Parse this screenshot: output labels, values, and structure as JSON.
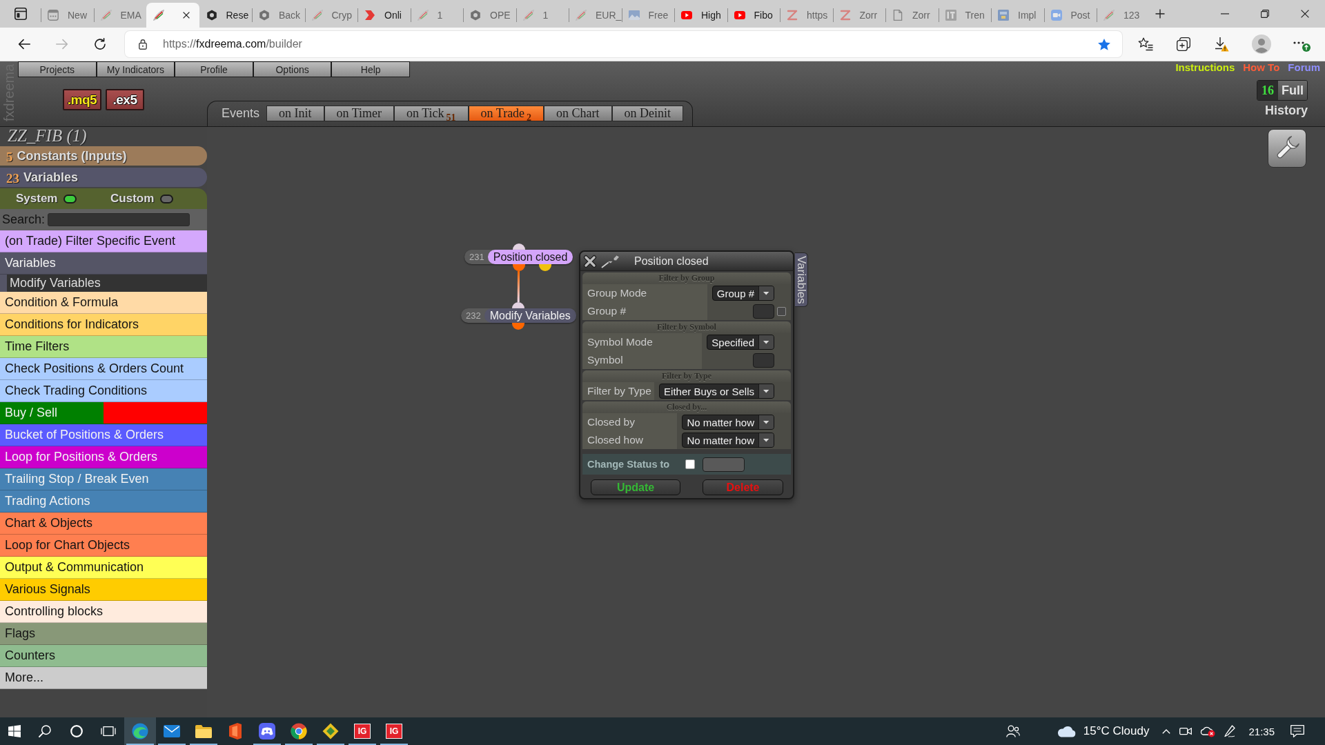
{
  "browser": {
    "tabs": [
      {
        "label": "New",
        "kind": "grid",
        "selected": false,
        "sleeping": true
      },
      {
        "label": "EMA",
        "kind": "quill",
        "selected": false,
        "sleeping": true
      },
      {
        "kind": "quill",
        "selected": true,
        "sleeping": false
      },
      {
        "label": "Rese",
        "kind": "hexagon",
        "selected": false,
        "sleeping": false
      },
      {
        "label": "Back",
        "kind": "hexagon",
        "selected": false,
        "sleeping": true
      },
      {
        "label": "Cryp",
        "kind": "quill",
        "selected": false,
        "sleeping": true
      },
      {
        "label": "Onli",
        "kind": "chevron",
        "selected": false,
        "sleeping": false
      },
      {
        "label": "1",
        "kind": "quill",
        "selected": false,
        "sleeping": true
      },
      {
        "label": "OPE",
        "kind": "hexagon",
        "selected": false,
        "sleeping": true
      },
      {
        "label": "1",
        "kind": "quill",
        "selected": false,
        "sleeping": true
      },
      {
        "label": "EUR_",
        "kind": "quill",
        "selected": false,
        "sleeping": true
      },
      {
        "label": "Free",
        "kind": "image",
        "selected": false,
        "sleeping": true
      },
      {
        "label": "High",
        "kind": "play",
        "selected": false,
        "sleeping": false
      },
      {
        "label": "Fibo",
        "kind": "play",
        "selected": false,
        "sleeping": false
      },
      {
        "label": "https",
        "kind": "zigzag",
        "selected": false,
        "sleeping": true
      },
      {
        "label": "Zorr",
        "kind": "zigzag",
        "selected": false,
        "sleeping": true
      },
      {
        "label": "Zorr",
        "kind": "document",
        "selected": false,
        "sleeping": true
      },
      {
        "label": "Tren",
        "kind": "tile",
        "selected": false,
        "sleeping": true
      },
      {
        "label": "Impl",
        "kind": "square",
        "selected": false,
        "sleeping": true
      },
      {
        "label": "Post",
        "kind": "camera",
        "selected": false,
        "sleeping": true
      },
      {
        "label": "123",
        "kind": "quill",
        "selected": false,
        "sleeping": true
      }
    ],
    "nav": [
      {
        "kind": "back",
        "disabled": false
      },
      {
        "kind": "forward",
        "disabled": true
      },
      {
        "kind": "reload",
        "disabled": false
      }
    ],
    "address": {
      "scheme": "https://",
      "host": "fxdreema.com",
      "path": "/builder",
      "bookmarked": true
    }
  },
  "app": {
    "logo": "fxdreema",
    "menu": [
      "Projects",
      "My Indicators",
      "Profile",
      "Options",
      "Help"
    ],
    "links": [
      {
        "label": "Instructions",
        "color": "#ccee11"
      },
      {
        "label": "How To",
        "color": "#ff5c38"
      },
      {
        "label": "Forum",
        "color": "#8f8fff"
      }
    ],
    "exports": [
      ".mq5",
      ".ex5"
    ],
    "history": {
      "count": "16",
      "mode": "Full",
      "label": "History"
    },
    "events": {
      "label": "Events",
      "tabs": [
        {
          "label": "on Init",
          "selected": false
        },
        {
          "label": "on Timer",
          "selected": false
        },
        {
          "label": "on Tick",
          "count": "51",
          "selected": false
        },
        {
          "label": "on Trade",
          "count": "2",
          "selected": true
        },
        {
          "label": "on Chart",
          "selected": false
        },
        {
          "label": "on Deinit",
          "selected": false
        }
      ]
    },
    "project": "ZZ_FIB (1)",
    "sidebar": {
      "constants": {
        "count": "5",
        "label": "Constants (Inputs)"
      },
      "variables": {
        "count": "23",
        "label": "Variables"
      },
      "toggles": [
        {
          "label": "System",
          "on": true
        },
        {
          "label": "Custom",
          "on": false
        }
      ],
      "search": {
        "label": "Search:"
      },
      "categories": [
        {
          "label": "(on Trade) Filter Specific Event",
          "color": "#d4a8fc"
        },
        {
          "label": "Variables",
          "color": "#555566",
          "children": [
            {
              "label": "Modify Variables"
            }
          ]
        },
        {
          "label": "Condition & Formula",
          "color": "#ffdaa6"
        },
        {
          "label": "Conditions for Indicators",
          "color": "#ffd466"
        },
        {
          "label": "Time Filters",
          "color": "#b0e286"
        },
        {
          "label": "Check Positions & Orders Count",
          "color": "#aaccff"
        },
        {
          "label": "Check Trading Conditions",
          "color": "#aaccff"
        },
        {
          "label": "Buy / Sell",
          "color": "#008000",
          "bands": [
            {
              "color": "#ff0000"
            }
          ]
        },
        {
          "label": "Bucket of Positions & Orders",
          "color": "#5b5bff"
        },
        {
          "label": "Loop for Positions & Orders",
          "color": "#cc00cc"
        },
        {
          "label": "Trailing Stop / Break Even",
          "color": "#4682b4"
        },
        {
          "label": "Trading Actions",
          "color": "#4682b4"
        },
        {
          "label": "Chart & Objects",
          "color": "#ff7f50"
        },
        {
          "label": "Loop for Chart Objects",
          "color": "#ff7f50"
        },
        {
          "label": "Output & Communication",
          "color": "#ffff55"
        },
        {
          "label": "Various Signals",
          "color": "#ffcc00"
        },
        {
          "label": "Controlling blocks",
          "color": "#ffebdd"
        },
        {
          "label": "Flags",
          "color": "#889878"
        },
        {
          "label": "Counters",
          "color": "#8fbc8f"
        },
        {
          "label": "More...",
          "color": "#cccccc"
        }
      ]
    },
    "canvas": {
      "nodes": [
        {
          "number": "231",
          "label": "Position closed",
          "color": "#d4a5fa",
          "outputs": [
            {
              "color": "#ff6600",
              "linked": true
            },
            {
              "color": "#f0c20c",
              "linked": false
            }
          ]
        },
        {
          "number": "232",
          "label": "Modify Variables",
          "color": "#55556a",
          "outputs": [
            {
              "color": "#ff6600",
              "linked": false
            }
          ]
        }
      ]
    },
    "dialog": {
      "title": "Position closed",
      "side_tab": "Variables",
      "sections": [
        {
          "title": "Filter by Group",
          "rows": [
            {
              "label": "Group Mode",
              "kind": "select",
              "value": "Group #"
            },
            {
              "label": "Group #",
              "kind": "field",
              "checked": false
            }
          ]
        },
        {
          "title": "Filter by Symbol",
          "rows": [
            {
              "label": "Symbol Mode",
              "kind": "select",
              "value": "Specified"
            },
            {
              "label": "Symbol",
              "kind": "field"
            }
          ]
        },
        {
          "title": "Filter by Type",
          "rows": [
            {
              "label": "Filter by Type",
              "kind": "select",
              "value": "Either Buys or Sells"
            }
          ]
        },
        {
          "title": "Closed by...",
          "rows": [
            {
              "label": "Closed by",
              "kind": "select",
              "value": "No matter how"
            },
            {
              "label": "Closed how",
              "kind": "select",
              "value": "No matter how"
            }
          ]
        }
      ],
      "status": {
        "label": "Change Status to",
        "checked": false
      },
      "buttons": [
        {
          "label": "Update",
          "color": "#35b835"
        },
        {
          "label": "Delete",
          "color": "#e81010"
        }
      ]
    }
  },
  "taskbar": {
    "apps": [
      {
        "kind": "browser",
        "running": true,
        "selected": true
      },
      {
        "kind": "mail",
        "running": true,
        "selected": false
      },
      {
        "kind": "folder",
        "running": true,
        "selected": false
      },
      {
        "kind": "office",
        "running": false,
        "selected": false
      },
      {
        "kind": "chat",
        "running": true,
        "selected": false
      },
      {
        "kind": "globe",
        "running": true,
        "selected": false
      },
      {
        "kind": "diamond",
        "running": true,
        "selected": false
      },
      {
        "kind": "tile",
        "label": "IG",
        "running": true,
        "selected": false
      },
      {
        "kind": "tile",
        "label": "IG",
        "running": true,
        "selected": false
      }
    ],
    "weather": "15°C Cloudy",
    "clock": "21:35"
  }
}
